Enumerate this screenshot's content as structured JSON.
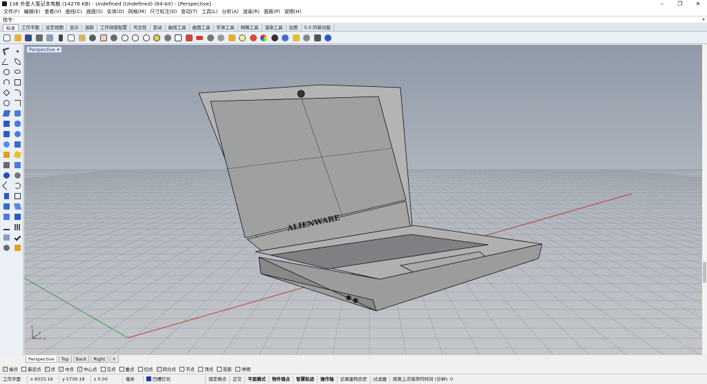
{
  "window": {
    "title": "138 外星人笔记本电脑 (14276 KB) - Undefined (Undefined) (64-bit) - [Perspective]",
    "buttons": [
      "–",
      "❐",
      "✕"
    ]
  },
  "menu": [
    "文件(F)",
    "编辑(E)",
    "查看(V)",
    "曲线(C)",
    "曲面(S)",
    "实体(O)",
    "网格(M)",
    "尺寸标注(D)",
    "变动(T)",
    "工具(L)",
    "分析(A)",
    "渲染(R)",
    "面板(P)",
    "说明(H)"
  ],
  "command": {
    "label": "指令:",
    "value": ""
  },
  "tabs": [
    "标准",
    "工作平面",
    "设定视图",
    "显示",
    "选取",
    "工作视窗配置",
    "可见性",
    "变动",
    "曲线工具",
    "曲面工具",
    "实体工具",
    "网格工具",
    "渲染工具",
    "出图",
    "5.0 的新功能"
  ],
  "toolbar_icons": [
    "new-icon",
    "open-icon",
    "save-icon",
    "print-icon",
    "import-icon",
    "cut-icon",
    "copy-icon",
    "paste-icon",
    "undo-icon",
    "pan-icon",
    "rotate-icon",
    "zoom-icon",
    "zoom-window-icon",
    "zoom-extents-icon",
    "zoom-selected-icon",
    "undo-view-icon",
    "four-view-icon",
    "set-cplane-icon",
    "car-icon",
    "hide-icon",
    "show-icon",
    "lock-icon",
    "light-icon",
    "material-icon",
    "render-icon",
    "sphere-icon",
    "object-properties-icon",
    "dimension-icon",
    "options-icon",
    "grid-snap-icon",
    "help-icon"
  ],
  "viewport": {
    "label": "Perspective",
    "brand": "ALIENWARE",
    "axis": [
      "x",
      "y",
      "z"
    ]
  },
  "viewport_tabs": [
    "Perspective",
    "Top",
    "Back",
    "Right",
    "+"
  ],
  "osnaps": [
    {
      "label": "端点",
      "checked": true
    },
    {
      "label": "最近点",
      "checked": false
    },
    {
      "label": "点",
      "checked": true
    },
    {
      "label": "中点",
      "checked": true
    },
    {
      "label": "中心点",
      "checked": true
    },
    {
      "label": "交点",
      "checked": false
    },
    {
      "label": "垂点",
      "checked": false
    },
    {
      "label": "切点",
      "checked": false
    },
    {
      "label": "四分点",
      "checked": true
    },
    {
      "label": "节点",
      "checked": false
    },
    {
      "label": "顶点",
      "checked": false
    },
    {
      "label": "投影",
      "checked": false
    },
    {
      "label": "停用",
      "checked": false
    }
  ],
  "status": {
    "cplane": "工作平面",
    "x": "x 8333.16",
    "y": "y 5730.18",
    "z": "z 0.00",
    "unit": "毫米",
    "layer": "凹槽灯光",
    "lock_grid": "锁定格点",
    "ortho": "正交",
    "planar": "平面模式",
    "osnap": "物件锁点",
    "smarttrack": "智慧轨迹",
    "gumball": "操作轴",
    "history": "记录建构历史",
    "filter": "过滤器",
    "autosave": "距离上次保存的时间 (分钟): 0"
  },
  "colors": {
    "viewport_top": "#8f99a8",
    "viewport_bottom": "#c4c6ca",
    "grid": "#9aa0a8",
    "x_axis": "#b83a3a",
    "y_axis": "#3a9a3a",
    "layer_swatch": "#1c3aa8"
  }
}
